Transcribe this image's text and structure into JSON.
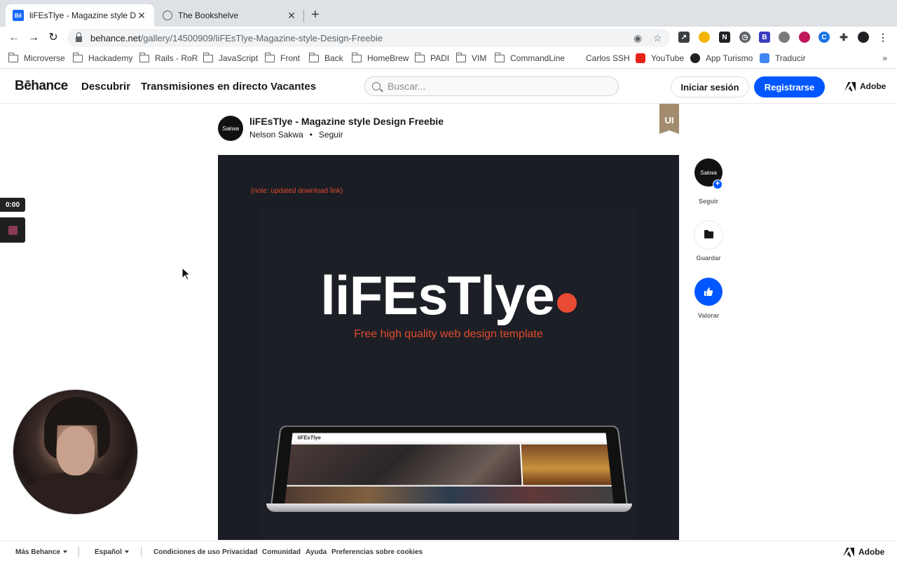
{
  "browser": {
    "tabs": [
      {
        "title": "liFEsTlye - Magazine style Desi",
        "favicon": "behance-icon"
      },
      {
        "title": "The Bookshelve",
        "favicon": "globe-icon"
      }
    ],
    "url_host": "behance.net",
    "url_path": "/gallery/14500909/liFEsTlye-Magazine-style-Design-Freebie",
    "bookmarks": [
      "Microverse",
      "Hackademy",
      "Rails - RoR",
      "JavaScript",
      "Front",
      "Back",
      "HomeBrew",
      "PADI",
      "VIM",
      "CommandLine",
      "Carlos SSH",
      "YouTube",
      "App Turismo",
      "Traducir"
    ],
    "bookmarks_more": "»"
  },
  "header": {
    "logo": "Bēhance",
    "nav": [
      "Descubrir",
      "Transmisiones en directo",
      "Vacantes"
    ],
    "search_placeholder": "Buscar...",
    "login": "Iniciar sesión",
    "register": "Registrarse",
    "adobe": "Adobe"
  },
  "project": {
    "title": "liFEsTlye - Magazine style Design Freebie",
    "owner": "Nelson Sakwa",
    "bullet": "•",
    "follow": "Seguir",
    "avatar_text": "Sakwa",
    "ribbon": "UI",
    "note": "(note: updated download link)",
    "hero_title": "liFEsTlye",
    "hero_subtitle": "Free high quality web design  template",
    "screen_logo": "liFEsTlye"
  },
  "actions": {
    "follow": "Seguir",
    "save": "Guardar",
    "appreciate": "Valorar",
    "plus": "+"
  },
  "recorder": {
    "time": "0:00"
  },
  "footer": {
    "more": "Más Behance",
    "language": "Español",
    "links": [
      "Condiciones de uso",
      "Privacidad",
      "Comunidad",
      "Ayuda",
      "Preferencias sobre cookies"
    ],
    "adobe": "Adobe"
  },
  "colors": {
    "brand_blue": "#0057ff",
    "accent_red": "#e84b32",
    "canvas_bg": "#1a1d24"
  }
}
